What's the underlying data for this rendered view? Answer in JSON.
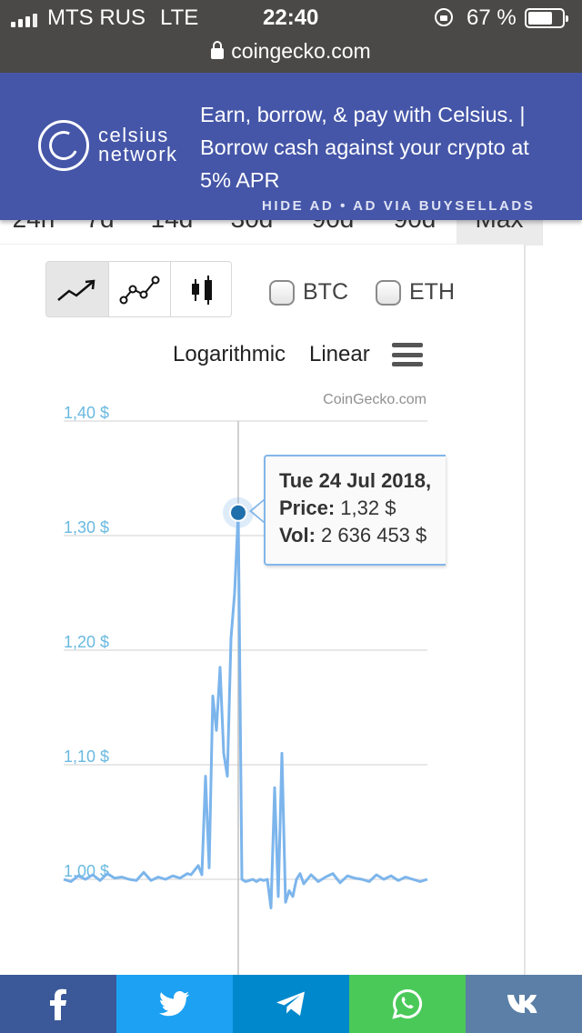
{
  "status_bar": {
    "carrier": "MTS RUS",
    "network": "LTE",
    "time": "22:40",
    "battery": "67 %",
    "url": "coingecko.com"
  },
  "ad": {
    "brand_line1": "celsius",
    "brand_line2": "network",
    "text": "Earn, borrow, & pay with Celsius. | Borrow cash against your crypto at 5% APR",
    "footer": "HIDE AD • AD VIA BUYSELLADS",
    "color": "#4556a8"
  },
  "timeframe_tabs": [
    "24h",
    "7d",
    "14d",
    "30d",
    "90d",
    "90d",
    "Max"
  ],
  "active_timeframe": "Max",
  "chart_controls": {
    "chart_types": [
      "line-chart-icon",
      "point-line-chart-icon",
      "candlestick-icon"
    ],
    "active_chart_type": "line-chart-icon",
    "compare": [
      "BTC",
      "ETH"
    ],
    "scales": [
      "Logarithmic",
      "Linear"
    ]
  },
  "chart_data": {
    "type": "line",
    "credit": "CoinGecko.com",
    "ylabel": "",
    "ylim": [
      0.98,
      1.41
    ],
    "y_ticks": [
      {
        "value": 1.4,
        "label": "1,40 $"
      },
      {
        "value": 1.3,
        "label": "1,30 $"
      },
      {
        "value": 1.2,
        "label": "1,20 $"
      },
      {
        "value": 1.1,
        "label": "1,10 $"
      },
      {
        "value": 1.0,
        "label": "1,00 $"
      }
    ],
    "grid": true,
    "x_range": [
      0,
      100
    ],
    "x": [
      0,
      2,
      4,
      6,
      8,
      10,
      12,
      14,
      16,
      18,
      20,
      22,
      24,
      26,
      28,
      30,
      32,
      34,
      35,
      36,
      37,
      38,
      39,
      40,
      41,
      42,
      43,
      44,
      45,
      46,
      47,
      48,
      49,
      50,
      51,
      52,
      53,
      54,
      55,
      56,
      57,
      58,
      59,
      60,
      61,
      62,
      63,
      64,
      65,
      66,
      67,
      68,
      70,
      72,
      74,
      76,
      78,
      80,
      82,
      84,
      86,
      88,
      90,
      92,
      94,
      96,
      98,
      100
    ],
    "values": [
      1.0,
      0.998,
      1.003,
      1.0,
      1.004,
      0.999,
      1.005,
      1.001,
      1.002,
      1.0,
      0.999,
      1.006,
      0.999,
      1.002,
      1.0,
      1.003,
      1.001,
      1.005,
      1.004,
      1.008,
      1.012,
      1.004,
      1.09,
      1.01,
      1.16,
      1.13,
      1.185,
      1.11,
      1.09,
      1.21,
      1.25,
      1.32,
      1.0,
      0.998,
      0.999,
      1.0,
      0.998,
      1.0,
      0.999,
      1.0,
      0.975,
      1.08,
      0.985,
      1.11,
      0.98,
      0.99,
      0.985,
      1.0,
      1.005,
      0.996,
      1.0,
      1.004,
      0.998,
      1.002,
      1.005,
      0.997,
      1.003,
      1.001,
      1.0,
      0.998,
      1.004,
      1.0,
      1.003,
      0.999,
      1.002,
      1.0,
      0.998,
      1.0
    ],
    "highlight_index": 31,
    "line_color": "#7cb5ec",
    "point_color": "#1f6fad",
    "crosshair_color": "#c0c0c0"
  },
  "tooltip": {
    "date": "Tue 24 Jul 2018,",
    "price_label": "Price:",
    "price_value": "1,32 $",
    "vol_label": "Vol:",
    "vol_value": "2 636 453 $"
  },
  "share_bar": {
    "items": [
      {
        "name": "facebook-icon",
        "color": "#3b5998"
      },
      {
        "name": "twitter-icon",
        "color": "#1da1f2"
      },
      {
        "name": "telegram-icon",
        "color": "#0088cc"
      },
      {
        "name": "whatsapp-icon",
        "color": "#4ac959"
      },
      {
        "name": "vk-icon",
        "color": "#5b7fa6"
      }
    ]
  }
}
